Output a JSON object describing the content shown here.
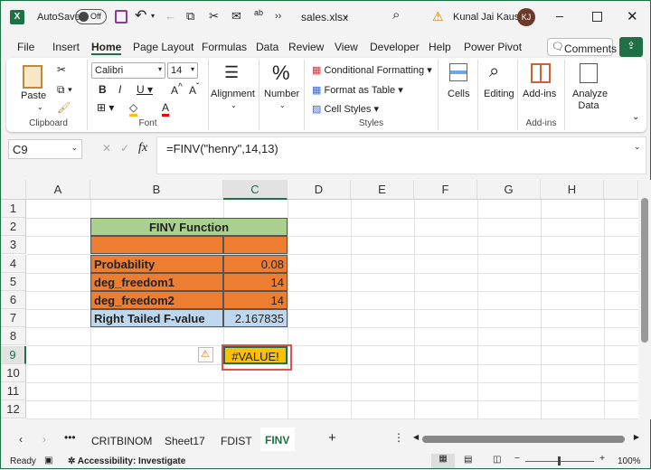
{
  "titlebar": {
    "autosave": "AutoSave",
    "toggle": "Off",
    "filename": "sales.xlsx",
    "user": "Kunal Jai Kaushik",
    "initials": "KJ"
  },
  "menu": [
    "File",
    "Insert",
    "Home",
    "Page Layout",
    "Formulas",
    "Data",
    "Review",
    "View",
    "Developer",
    "Help",
    "Power Pivot"
  ],
  "comments": "Comments",
  "ribbon": {
    "paste": "Paste",
    "clipboard": "Clipboard",
    "font_name": "Calibri",
    "font_size": "14",
    "font": "Font",
    "alignment": "Alignment",
    "number": "Number",
    "cond_format": "Conditional Formatting",
    "format_table": "Format as Table",
    "cell_styles": "Cell Styles",
    "styles": "Styles",
    "cells": "Cells",
    "editing": "Editing",
    "addins": "Add-ins",
    "addins_group": "Add-ins",
    "analyze": "Analyze Data"
  },
  "formula_bar": {
    "name_box": "C9",
    "formula": "=FINV(\"henry\",14,13)",
    "fx": "fx"
  },
  "columns": [
    "A",
    "B",
    "C",
    "D",
    "E",
    "F",
    "G",
    "H"
  ],
  "rows": [
    "1",
    "2",
    "3",
    "4",
    "5",
    "6",
    "7",
    "8",
    "9",
    "10",
    "11",
    "12"
  ],
  "table": {
    "title": "FINV Function",
    "labels": [
      "Probability",
      "deg_freedom1",
      "deg_freedom2",
      "Right Tailed F-value"
    ],
    "values": [
      "0.08",
      "14",
      "14",
      "2.167835"
    ],
    "error": "#VALUE!"
  },
  "colors": {
    "green_header": "#a9d08e",
    "orange": "#ed7d31",
    "blue": "#bdd7ee",
    "error_fill": "#ffc000",
    "accent": "#1e7145"
  },
  "sheets": [
    "CRITBINOM",
    "Sheet17",
    "FDIST",
    "FINV"
  ],
  "active_sheet": "FINV",
  "status": {
    "ready": "Ready",
    "accessibility": "Accessibility: Investigate",
    "zoom": "100%"
  }
}
